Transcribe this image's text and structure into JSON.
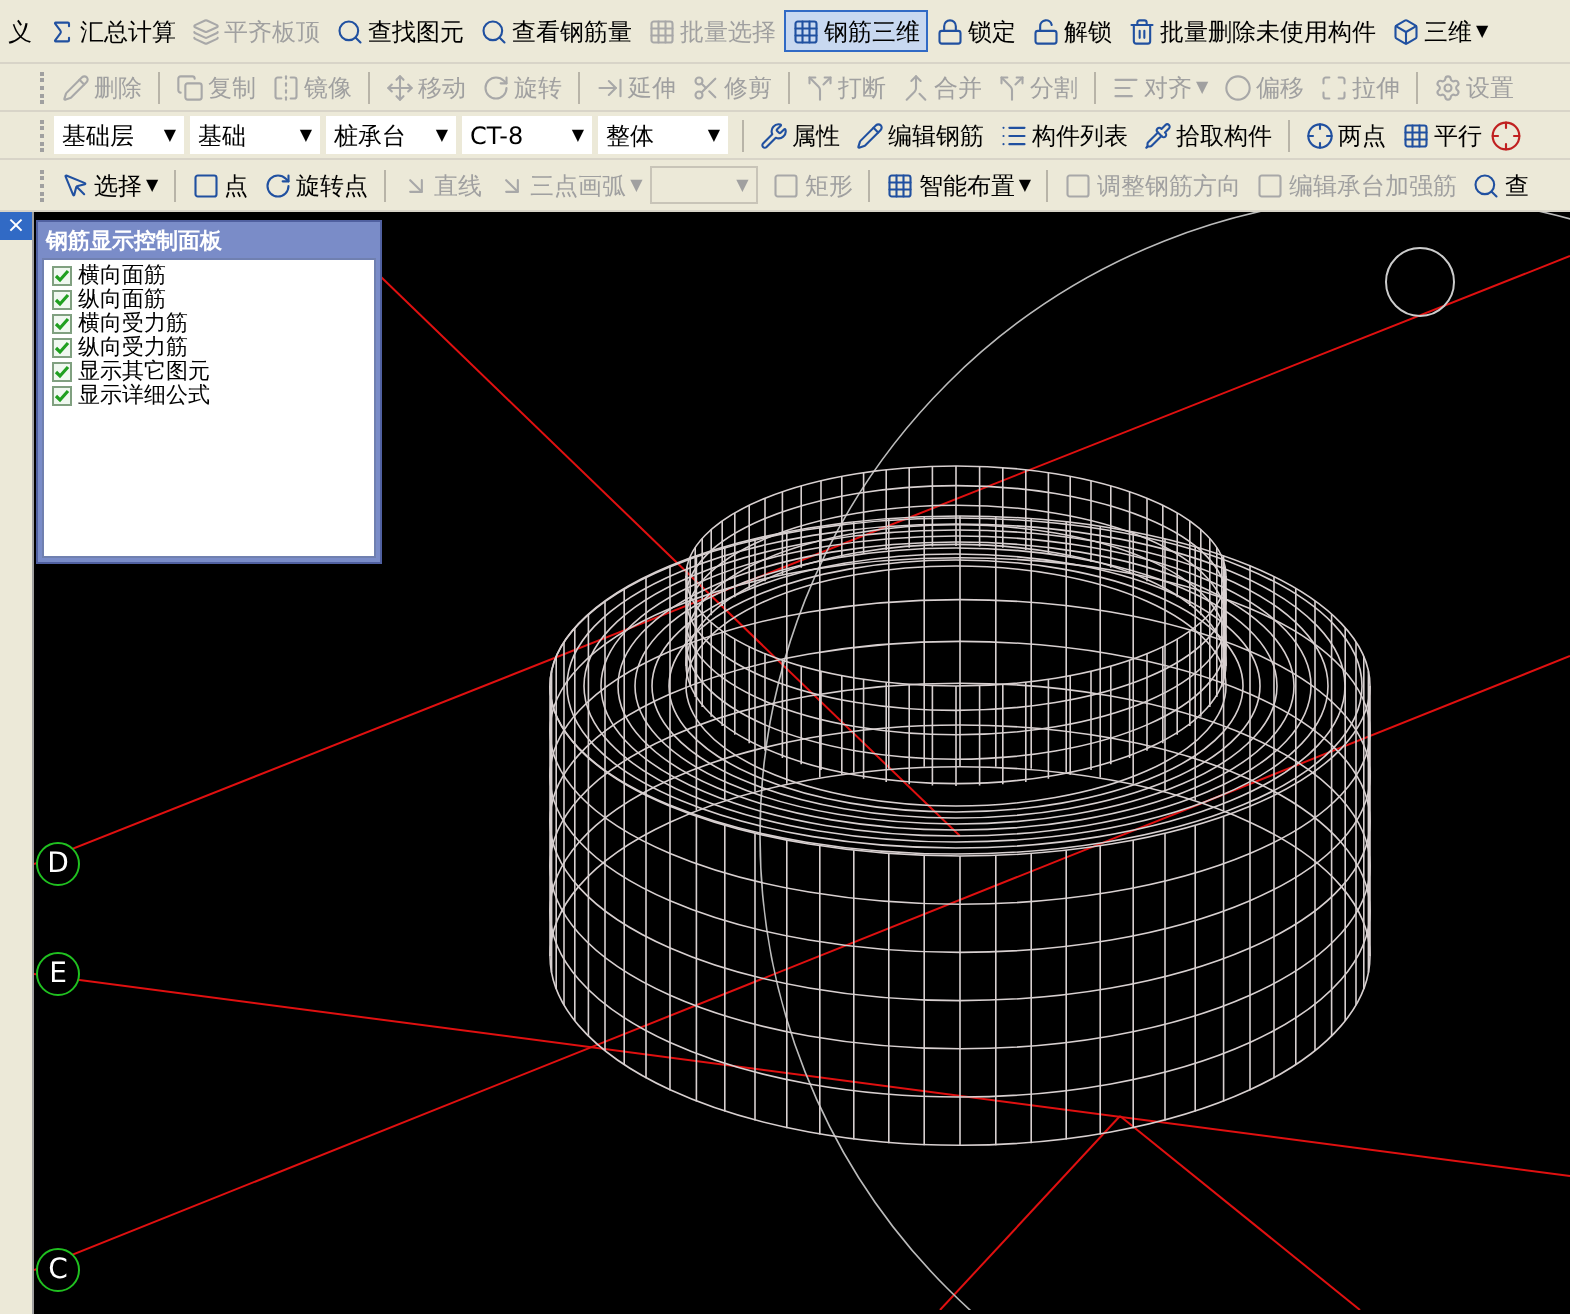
{
  "toolbars": [
    {
      "items": [
        {
          "kind": "button",
          "label": "义",
          "disabled": false,
          "selected": false
        },
        {
          "kind": "button",
          "label": "汇总计算",
          "disabled": false,
          "selected": false
        },
        {
          "kind": "button",
          "label": "平齐板顶",
          "disabled": true,
          "selected": false
        },
        {
          "kind": "button",
          "label": "查找图元",
          "disabled": false,
          "selected": false
        },
        {
          "kind": "button",
          "label": "查看钢筋量",
          "disabled": false,
          "selected": false
        },
        {
          "kind": "button",
          "label": "批量选择",
          "disabled": true,
          "selected": false
        },
        {
          "kind": "button",
          "label": "钢筋三维",
          "disabled": false,
          "selected": true
        },
        {
          "kind": "button",
          "label": "锁定",
          "disabled": false,
          "selected": false
        },
        {
          "kind": "button",
          "label": "解锁",
          "disabled": false,
          "selected": false
        },
        {
          "kind": "button",
          "label": "批量删除未使用构件",
          "disabled": false,
          "selected": false
        },
        {
          "kind": "menu",
          "label": "三维",
          "caret": "▼",
          "disabled": false
        }
      ]
    },
    {
      "items": [
        {
          "kind": "button",
          "label": "删除",
          "disabled": true
        },
        {
          "kind": "separator"
        },
        {
          "kind": "button",
          "label": "复制",
          "disabled": true
        },
        {
          "kind": "button",
          "label": "镜像",
          "disabled": true
        },
        {
          "kind": "separator"
        },
        {
          "kind": "button",
          "label": "移动",
          "disabled": true
        },
        {
          "kind": "button",
          "label": "旋转",
          "disabled": true
        },
        {
          "kind": "separator"
        },
        {
          "kind": "button",
          "label": "延伸",
          "disabled": true
        },
        {
          "kind": "button",
          "label": "修剪",
          "disabled": true
        },
        {
          "kind": "separator"
        },
        {
          "kind": "button",
          "label": "打断",
          "disabled": true
        },
        {
          "kind": "button",
          "label": "合并",
          "disabled": true
        },
        {
          "kind": "button",
          "label": "分割",
          "disabled": true
        },
        {
          "kind": "separator"
        },
        {
          "kind": "menu",
          "label": "对齐",
          "caret": "▼",
          "disabled": true
        },
        {
          "kind": "button",
          "label": "偏移",
          "disabled": true
        },
        {
          "kind": "button",
          "label": "拉伸",
          "disabled": true
        },
        {
          "kind": "separator"
        },
        {
          "kind": "button",
          "label": "设置",
          "disabled": true
        }
      ]
    },
    {
      "items": [
        {
          "kind": "select",
          "label": "基础层",
          "caret": "▼",
          "disabled": false
        },
        {
          "kind": "select",
          "label": "基础",
          "caret": "▼",
          "disabled": false
        },
        {
          "kind": "select",
          "label": "桩承台",
          "caret": "▼",
          "disabled": false
        },
        {
          "kind": "select",
          "label": "CT-8",
          "caret": "▼",
          "disabled": false
        },
        {
          "kind": "select",
          "label": "整体",
          "caret": "▼",
          "disabled": false
        },
        {
          "kind": "separator"
        },
        {
          "kind": "button",
          "label": "属性",
          "disabled": false
        },
        {
          "kind": "button",
          "label": "编辑钢筋",
          "disabled": false
        },
        {
          "kind": "button",
          "label": "构件列表",
          "disabled": false
        },
        {
          "kind": "button",
          "label": "拾取构件",
          "disabled": false
        },
        {
          "kind": "separator"
        },
        {
          "kind": "button",
          "label": "两点",
          "disabled": false
        },
        {
          "kind": "button",
          "label": "平行",
          "disabled": false
        },
        {
          "kind": "icon",
          "disabled": false
        }
      ]
    },
    {
      "items": [
        {
          "kind": "menu",
          "label": "选择",
          "caret": "▼",
          "disabled": false
        },
        {
          "kind": "separator"
        },
        {
          "kind": "button",
          "label": "点",
          "disabled": false
        },
        {
          "kind": "button",
          "label": "旋转点",
          "disabled": false
        },
        {
          "kind": "separator"
        },
        {
          "kind": "button",
          "label": "直线",
          "disabled": true
        },
        {
          "kind": "menu",
          "label": "三点画弧",
          "caret": "▼",
          "disabled": true
        },
        {
          "kind": "select",
          "caret": "▼",
          "disabled": true
        },
        {
          "kind": "button",
          "label": "矩形",
          "disabled": true
        },
        {
          "kind": "separator"
        },
        {
          "kind": "menu",
          "label": "智能布置",
          "caret": "▼",
          "disabled": false
        },
        {
          "kind": "separator"
        },
        {
          "kind": "button",
          "label": "调整钢筋方向",
          "disabled": true
        },
        {
          "kind": "button",
          "label": "编辑承台加强筋",
          "disabled": true
        },
        {
          "kind": "button",
          "label": "查",
          "disabled": false
        }
      ]
    }
  ],
  "side_close": "×",
  "panel": {
    "title": "钢筋显示控制面板",
    "options": [
      {
        "label": "横向面筋",
        "checked": true
      },
      {
        "label": "纵向面筋",
        "checked": true
      },
      {
        "label": "横向受力筋",
        "checked": true
      },
      {
        "label": "纵向受力筋",
        "checked": true
      },
      {
        "label": "显示其它图元",
        "checked": true
      },
      {
        "label": "显示详细公式",
        "checked": true
      }
    ]
  },
  "axis_markers": [
    {
      "label": "D"
    },
    {
      "label": "E"
    },
    {
      "label": "C"
    }
  ]
}
